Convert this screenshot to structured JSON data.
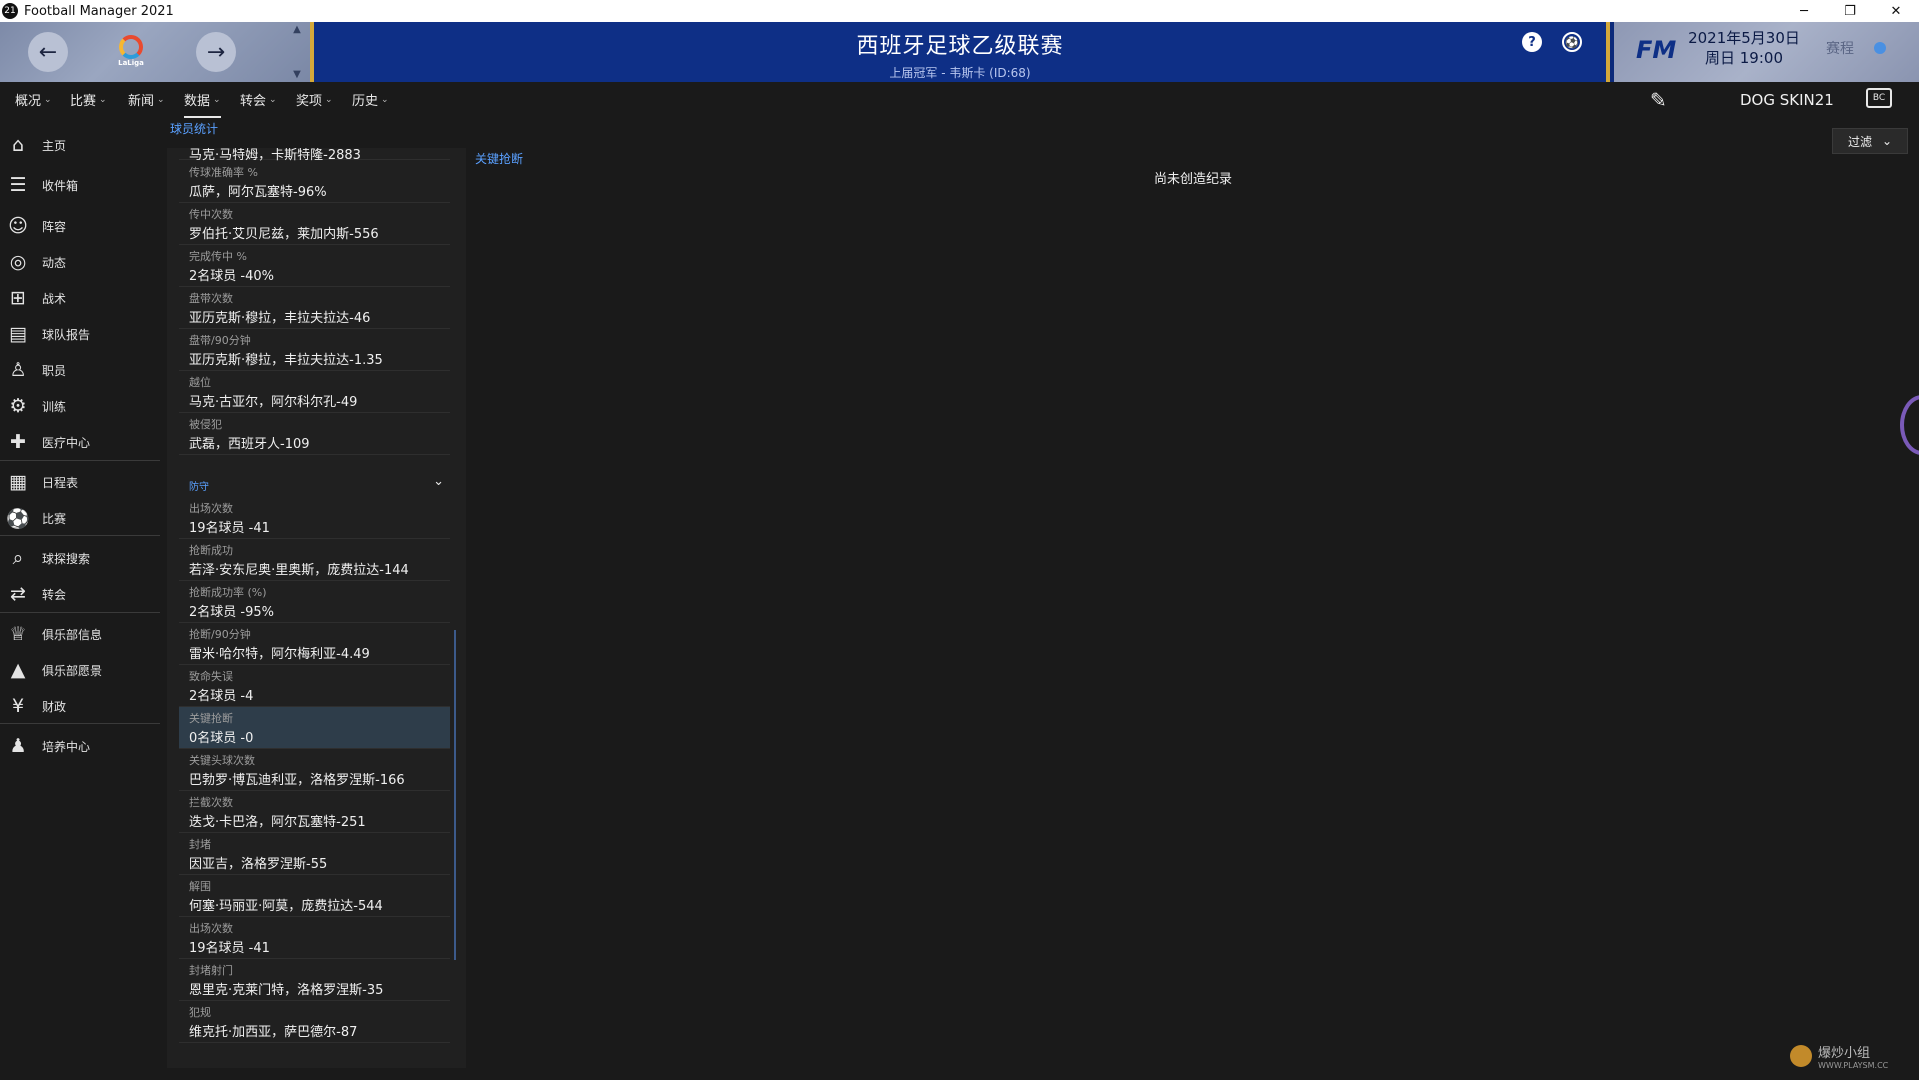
{
  "window": {
    "app_icon": "21",
    "title": "Football Manager 2021",
    "minimize": "─",
    "restore": "❐",
    "close": "✕"
  },
  "header": {
    "back_icon": "←",
    "forward_icon": "→",
    "league_logo_text": "LaLiga",
    "title": "西班牙足球乙级联赛",
    "subtitle": "上届冠军 - 韦斯卡 (ID:68)",
    "help_icon": "?",
    "ball_icon": "⚽",
    "fm_logo": "FM",
    "date": "2021年5月30日",
    "time": "周日 19:00",
    "continue_label": "赛程"
  },
  "menu": {
    "items": [
      {
        "label": "概况"
      },
      {
        "label": "比赛"
      },
      {
        "label": "新闻"
      },
      {
        "label": "数据"
      },
      {
        "label": "转会"
      },
      {
        "label": "奖项"
      },
      {
        "label": "历史"
      }
    ],
    "chevron": "⌄",
    "skin_label": "DOG SKIN21",
    "keyboard_icon": "BC"
  },
  "breadcrumb": "球员统计",
  "sidebar": {
    "items": [
      {
        "label": "主页",
        "icon": "⌂"
      },
      {
        "label": "收件箱",
        "icon": "☰"
      },
      {
        "label": "阵容",
        "icon": "☺"
      },
      {
        "label": "动态",
        "icon": "◎"
      },
      {
        "label": "战术",
        "icon": "⊞"
      },
      {
        "label": "球队报告",
        "icon": "▤"
      },
      {
        "label": "职员",
        "icon": "♙"
      },
      {
        "label": "训练",
        "icon": "⚙"
      },
      {
        "label": "医疗中心",
        "icon": "✚"
      },
      {
        "label": "日程表",
        "icon": "▦"
      },
      {
        "label": "比赛",
        "icon": "⚽"
      },
      {
        "label": "球探搜索",
        "icon": "⌕"
      },
      {
        "label": "转会",
        "icon": "⇄"
      },
      {
        "label": "俱乐部信息",
        "icon": "♕"
      },
      {
        "label": "俱乐部愿景",
        "icon": "▲"
      },
      {
        "label": "财政",
        "icon": "¥"
      },
      {
        "label": "培养中心",
        "icon": "♟"
      }
    ]
  },
  "stats": {
    "top_cut_value": "马克·马特姆，卡斯特隆-2883",
    "attack_rows": [
      {
        "label": "传球准确率 %",
        "value": "瓜萨，阿尔瓦塞特-96%"
      },
      {
        "label": "传中次数",
        "value": "罗伯托·艾贝尼兹，莱加内斯-556"
      },
      {
        "label": "完成传中 %",
        "value": "2名球员 -40%"
      },
      {
        "label": "盘带次数",
        "value": "亚历克斯·穆拉，丰拉夫拉达-46"
      },
      {
        "label": "盘带/90分钟",
        "value": "亚历克斯·穆拉，丰拉夫拉达-1.35"
      },
      {
        "label": "越位",
        "value": "马克·古亚尔，阿尔科尔孔-49"
      },
      {
        "label": "被侵犯",
        "value": "武磊，西班牙人-109"
      }
    ],
    "defense_section_label": "防守",
    "defense_rows": [
      {
        "label": "出场次数",
        "value": "19名球员 -41"
      },
      {
        "label": "抢断成功",
        "value": "若泽·安东尼奥·里奥斯，庞费拉达-144"
      },
      {
        "label": "抢断成功率 (%)",
        "value": "2名球员 -95%"
      },
      {
        "label": "抢断/90分钟",
        "value": "雷米·哈尔特，阿尔梅利亚-4.49"
      },
      {
        "label": "致命失误",
        "value": "2名球员 -4"
      },
      {
        "label": "关键抢断",
        "value": "0名球员 -0"
      },
      {
        "label": "关键头球次数",
        "value": "巴勃罗·博瓦迪利亚，洛格罗涅斯-166"
      },
      {
        "label": "拦截次数",
        "value": "迭戈·卡巴洛，阿尔瓦塞特-251"
      },
      {
        "label": "封堵",
        "value": "因亚吉，洛格罗涅斯-55"
      },
      {
        "label": "解围",
        "value": "何塞·玛丽亚·阿莫，庞费拉达-544"
      },
      {
        "label": "出场次数",
        "value": "19名球员 -41"
      },
      {
        "label": "封堵射门",
        "value": "恩里克·克莱门特，洛格罗涅斯-35"
      },
      {
        "label": "犯规",
        "value": "维克托·加西亚，萨巴德尔-87"
      }
    ],
    "selected_index": 5
  },
  "detail": {
    "title": "关键抢断",
    "empty_message": "尚未创造纪录",
    "filter_label": "过滤"
  },
  "watermark": {
    "text": "爆炒小组",
    "sub": "WWW.PLAYSM.CC"
  },
  "colors": {
    "accent_blue": "#5aa0ff",
    "header_blue": "#0e2f86",
    "gold_border": "#d4a93b",
    "selected_row": "#2e3d4a"
  }
}
